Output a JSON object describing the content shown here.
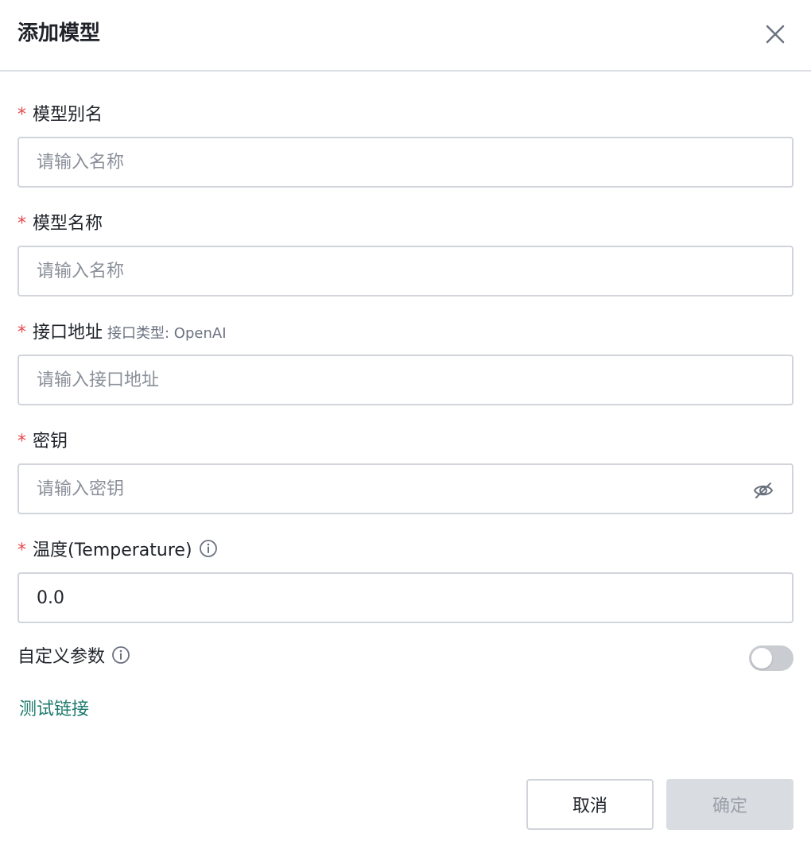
{
  "dialog": {
    "title": "添加模型"
  },
  "fields": {
    "alias": {
      "label": "模型别名",
      "placeholder": "请输入名称",
      "value": ""
    },
    "name": {
      "label": "模型名称",
      "placeholder": "请输入名称",
      "value": ""
    },
    "endpoint": {
      "label": "接口地址",
      "sublabel": "接口类型: OpenAI",
      "placeholder": "请输入接口地址",
      "value": ""
    },
    "key": {
      "label": "密钥",
      "placeholder": "请输入密钥",
      "value": ""
    },
    "temperature": {
      "label": "温度(Temperature)",
      "placeholder": "",
      "value": "0.0"
    }
  },
  "required_mark": "*",
  "custom_params": {
    "label": "自定义参数",
    "enabled": false
  },
  "test_link": "测试链接",
  "buttons": {
    "cancel": "取消",
    "confirm": "确定"
  },
  "colors": {
    "required": "#e5484d",
    "link": "#1e7a6e",
    "confirm_disabled_bg": "#d9dde2",
    "toggle_off": "#c9ccd1"
  }
}
